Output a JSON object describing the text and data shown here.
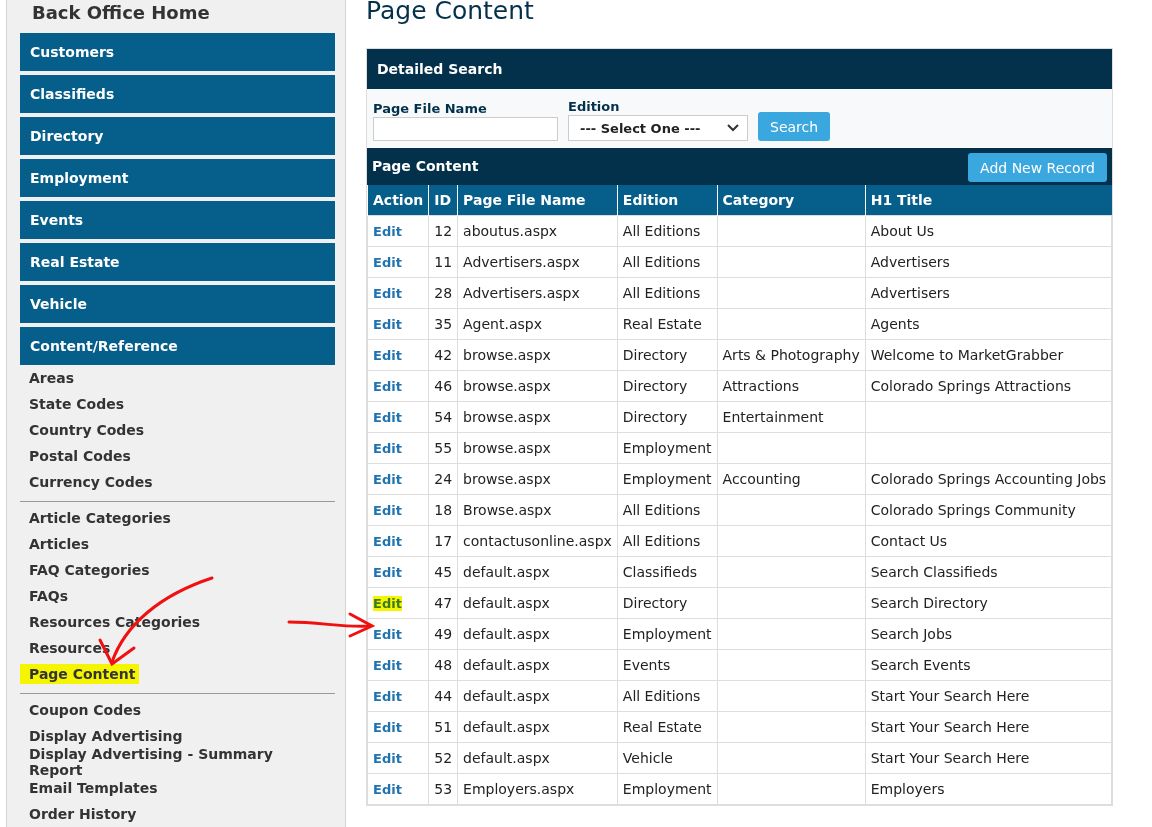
{
  "sidebar": {
    "title": "Back Office Home",
    "nav": [
      "Customers",
      "Classifieds",
      "Directory",
      "Employment",
      "Events",
      "Real Estate",
      "Vehicle",
      "Content/Reference"
    ],
    "groups": [
      {
        "items": [
          {
            "label": "Areas",
            "highlighted": false
          },
          {
            "label": "State Codes",
            "highlighted": false
          },
          {
            "label": "Country Codes",
            "highlighted": false
          },
          {
            "label": "Postal Codes",
            "highlighted": false
          },
          {
            "label": "Currency Codes",
            "highlighted": false
          }
        ]
      },
      {
        "items": [
          {
            "label": "Article Categories",
            "highlighted": false
          },
          {
            "label": "Articles",
            "highlighted": false
          },
          {
            "label": "FAQ Categories",
            "highlighted": false
          },
          {
            "label": "FAQs",
            "highlighted": false
          },
          {
            "label": "Resources Categories",
            "highlighted": false
          },
          {
            "label": "Resources",
            "highlighted": false
          },
          {
            "label": "Page Content",
            "highlighted": true
          }
        ]
      },
      {
        "items": [
          {
            "label": "Coupon Codes",
            "highlighted": false
          },
          {
            "label": "Display Advertising",
            "highlighted": false
          },
          {
            "label": "Display Advertising - Summary Report",
            "highlighted": false
          },
          {
            "label": "Email Templates",
            "highlighted": false
          },
          {
            "label": "Order History",
            "highlighted": false
          }
        ]
      }
    ]
  },
  "page_title": "Page Content",
  "search": {
    "title": "Detailed Search",
    "fields": [
      {
        "label": "Page File Name"
      },
      {
        "label": "Edition",
        "value": "--- Select One ---"
      }
    ],
    "button": "Search"
  },
  "table": {
    "title": "Page Content",
    "add_button": "Add New Record",
    "columns": [
      "Action",
      "ID",
      "Page File Name",
      "Edition",
      "Category",
      "H1 Title"
    ],
    "rows": [
      {
        "action": "Edit",
        "highlighted": false,
        "id": "12",
        "file": "aboutus.aspx",
        "edition": "All Editions",
        "category": "",
        "title": "About Us"
      },
      {
        "action": "Edit",
        "highlighted": false,
        "id": "11",
        "file": "Advertisers.aspx",
        "edition": "All Editions",
        "category": "",
        "title": "Advertisers"
      },
      {
        "action": "Edit",
        "highlighted": false,
        "id": "28",
        "file": "Advertisers.aspx",
        "edition": "All Editions",
        "category": "",
        "title": "Advertisers"
      },
      {
        "action": "Edit",
        "highlighted": false,
        "id": "35",
        "file": "Agent.aspx",
        "edition": "Real Estate",
        "category": "",
        "title": "Agents"
      },
      {
        "action": "Edit",
        "highlighted": false,
        "id": "42",
        "file": "browse.aspx",
        "edition": "Directory",
        "category": "Arts & Photography",
        "title": "Welcome to MarketGrabber"
      },
      {
        "action": "Edit",
        "highlighted": false,
        "id": "46",
        "file": "browse.aspx",
        "edition": "Directory",
        "category": "Attractions",
        "title": "Colorado Springs Attractions"
      },
      {
        "action": "Edit",
        "highlighted": false,
        "id": "54",
        "file": "browse.aspx",
        "edition": "Directory",
        "category": "Entertainment",
        "title": ""
      },
      {
        "action": "Edit",
        "highlighted": false,
        "id": "55",
        "file": "browse.aspx",
        "edition": "Employment",
        "category": "",
        "title": ""
      },
      {
        "action": "Edit",
        "highlighted": false,
        "id": "24",
        "file": "browse.aspx",
        "edition": "Employment",
        "category": "Accounting",
        "title": "Colorado Springs Accounting Jobs"
      },
      {
        "action": "Edit",
        "highlighted": false,
        "id": "18",
        "file": "Browse.aspx",
        "edition": "All Editions",
        "category": "",
        "title": "Colorado Springs Community"
      },
      {
        "action": "Edit",
        "highlighted": false,
        "id": "17",
        "file": "contactusonline.aspx",
        "edition": "All Editions",
        "category": "",
        "title": "Contact Us"
      },
      {
        "action": "Edit",
        "highlighted": false,
        "id": "45",
        "file": "default.aspx",
        "edition": "Classifieds",
        "category": "",
        "title": "Search Classifieds"
      },
      {
        "action": "Edit",
        "highlighted": true,
        "id": "47",
        "file": "default.aspx",
        "edition": "Directory",
        "category": "",
        "title": "Search Directory"
      },
      {
        "action": "Edit",
        "highlighted": false,
        "id": "49",
        "file": "default.aspx",
        "edition": "Employment",
        "category": "",
        "title": "Search Jobs"
      },
      {
        "action": "Edit",
        "highlighted": false,
        "id": "48",
        "file": "default.aspx",
        "edition": "Events",
        "category": "",
        "title": "Search Events"
      },
      {
        "action": "Edit",
        "highlighted": false,
        "id": "44",
        "file": "default.aspx",
        "edition": "All Editions",
        "category": "",
        "title": "Start Your Search Here"
      },
      {
        "action": "Edit",
        "highlighted": false,
        "id": "51",
        "file": "default.aspx",
        "edition": "Real Estate",
        "category": "",
        "title": "Start Your Search Here"
      },
      {
        "action": "Edit",
        "highlighted": false,
        "id": "52",
        "file": "default.aspx",
        "edition": "Vehicle",
        "category": "",
        "title": "Start Your Search Here"
      },
      {
        "action": "Edit",
        "highlighted": false,
        "id": "53",
        "file": "Employers.aspx",
        "edition": "Employment",
        "category": "",
        "title": "Employers"
      }
    ]
  }
}
